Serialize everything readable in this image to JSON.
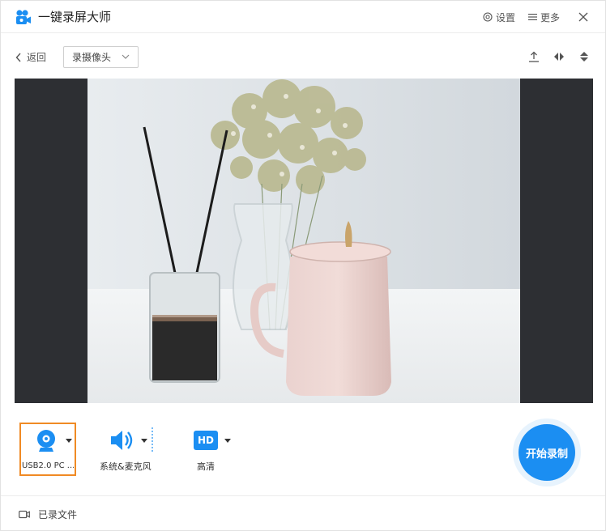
{
  "app": {
    "title": "一键录屏大师"
  },
  "titlebar": {
    "settings_label": "设置",
    "more_label": "更多"
  },
  "toolbar": {
    "back_label": "返回",
    "mode_value": "录摄像头"
  },
  "controls": {
    "camera_label": "USB2.0 PC ...",
    "audio_label": "系统&麦克风",
    "quality_badge": "HD",
    "quality_label": "高清",
    "record_label": "开始录制"
  },
  "footer": {
    "recorded_files_label": "已录文件"
  },
  "colors": {
    "accent": "#1b8ef2",
    "selected_border": "#f08a24",
    "preview_bg": "#2d2f33"
  },
  "icons": [
    "app-logo-icon",
    "settings-icon",
    "more-icon",
    "close-icon",
    "back-chevron-icon",
    "chevron-down-icon",
    "export-icon",
    "flip-horizontal-icon",
    "flip-vertical-icon",
    "webcam-icon",
    "speaker-icon",
    "hd-icon",
    "video-file-icon"
  ]
}
